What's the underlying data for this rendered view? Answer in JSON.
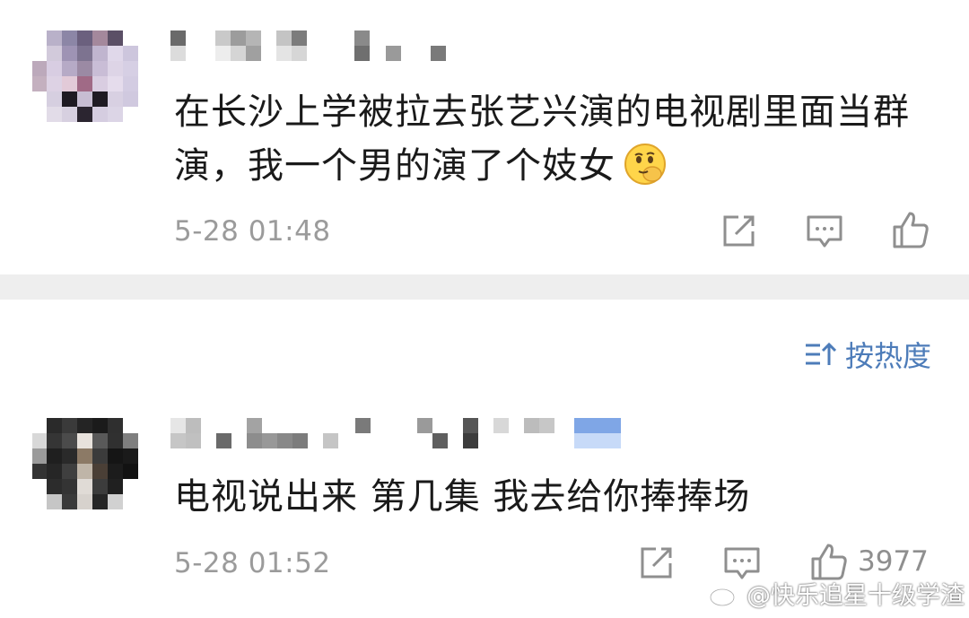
{
  "comments": [
    {
      "text": "在长沙上学被拉去张艺兴演的电视剧里面当群演，我一个男的演了个妓女",
      "emoji": "smirk-emoji",
      "time": "5-28 01:48",
      "likes": ""
    },
    {
      "text": "电视说出来  第几集  我去给你捧捧场",
      "time": "5-28 01:52",
      "likes": "3977"
    }
  ],
  "sort": {
    "label": "按热度"
  },
  "watermark": {
    "text": "@快乐追星十级学渣"
  },
  "colors": {
    "link": "#4d7cb9",
    "meta": "#9b9b9b",
    "divider": "#eeeeee"
  }
}
